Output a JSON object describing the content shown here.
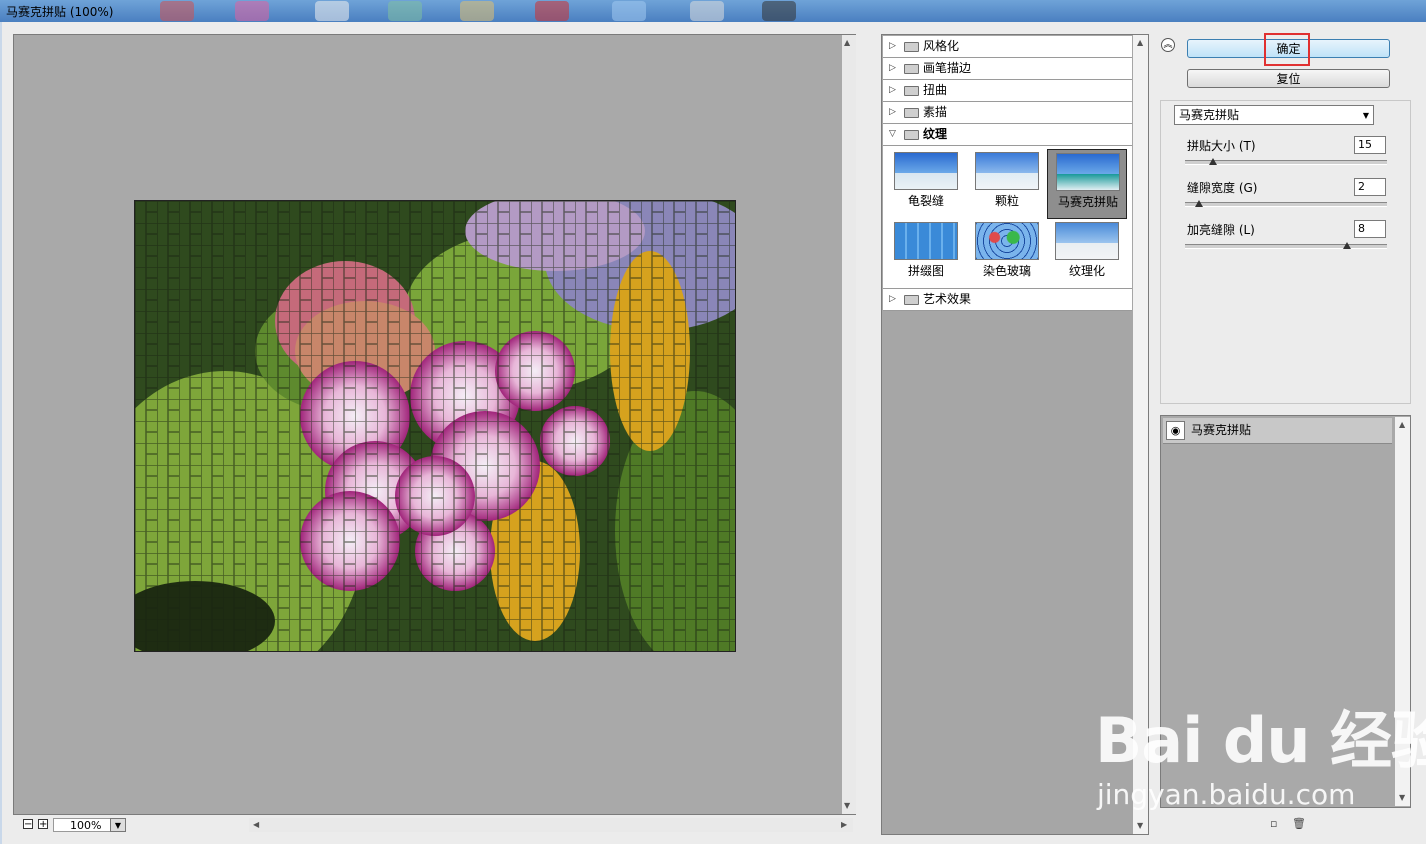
{
  "window": {
    "title": "马赛克拼贴 (100%)"
  },
  "preview": {
    "zoom": "100%"
  },
  "gallery": {
    "categories": [
      {
        "label": "风格化",
        "expanded": false
      },
      {
        "label": "画笔描边",
        "expanded": false
      },
      {
        "label": "扭曲",
        "expanded": false
      },
      {
        "label": "素描",
        "expanded": false
      },
      {
        "label": "纹理",
        "expanded": true
      },
      {
        "label": "艺术效果",
        "expanded": false
      }
    ],
    "texture_filters": [
      {
        "label": "龟裂缝",
        "selected": false
      },
      {
        "label": "颗粒",
        "selected": false
      },
      {
        "label": "马赛克拼贴",
        "selected": true
      },
      {
        "label": "拼缀图",
        "selected": false
      },
      {
        "label": "染色玻璃",
        "selected": false
      },
      {
        "label": "纹理化",
        "selected": false
      }
    ]
  },
  "buttons": {
    "ok": "确定",
    "reset": "复位"
  },
  "settings": {
    "filter_select": "马赛克拼贴",
    "params": [
      {
        "label": "拼贴大小 (T)",
        "value": "15",
        "level": 0.14
      },
      {
        "label": "缝隙宽度 (G)",
        "value": "2",
        "level": 0.07
      },
      {
        "label": "加亮缝隙 (L)",
        "value": "8",
        "level": 0.8
      }
    ]
  },
  "layers": {
    "items": [
      {
        "label": "马赛克拼贴"
      }
    ]
  },
  "watermark": {
    "brand": "Bai du 经验",
    "url": "jingyan.baidu.com"
  },
  "colors": {
    "accent_highlight": "#e03030",
    "preview_bg": "#a9a9a9"
  }
}
